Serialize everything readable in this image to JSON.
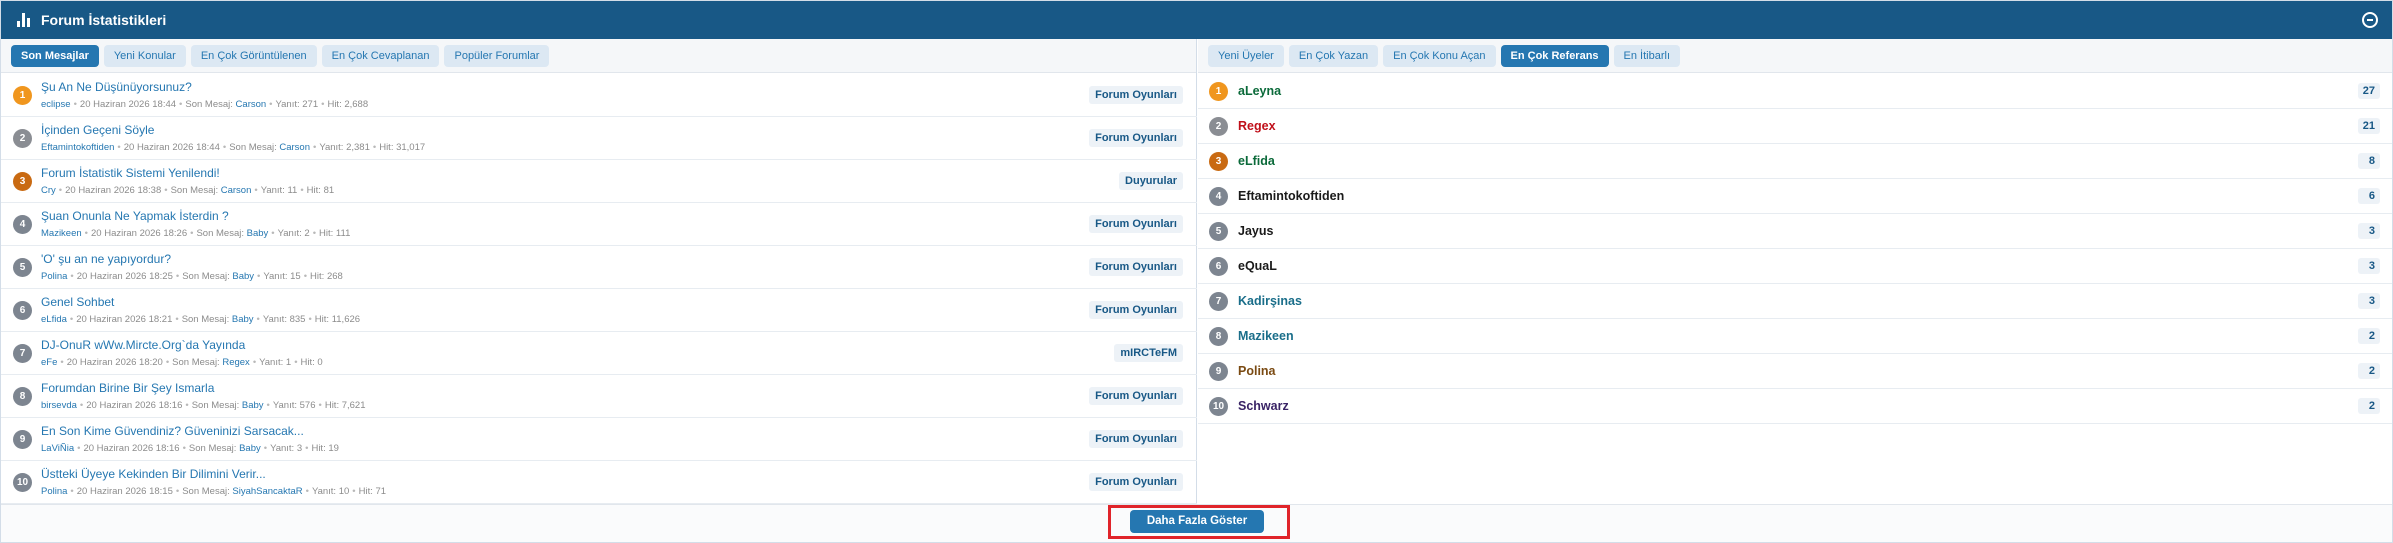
{
  "header": {
    "title": "Forum İstatistikleri",
    "icon": "bar-chart-icon",
    "toggle_icon": "collapse-icon"
  },
  "colors": {
    "header_bg": "#185886",
    "accent": "#2577b1",
    "gold": "#f0961e",
    "silver": "#8a8d93",
    "bronze": "#c96a12",
    "gray": "#7d8590"
  },
  "left_tabs": [
    {
      "label": "Son Mesajlar",
      "active": true
    },
    {
      "label": "Yeni Konular",
      "active": false
    },
    {
      "label": "En Çok Görüntülenen",
      "active": false
    },
    {
      "label": "En Çok Cevaplanan",
      "active": false
    },
    {
      "label": "Popüler Forumlar",
      "active": false
    }
  ],
  "right_tabs": [
    {
      "label": "Yeni Üyeler",
      "active": false
    },
    {
      "label": "En Çok Yazan",
      "active": false
    },
    {
      "label": "En Çok Konu Açan",
      "active": false
    },
    {
      "label": "En Çok Referans",
      "active": true
    },
    {
      "label": "En İtibarlı",
      "active": false
    }
  ],
  "labels": {
    "last_post": "Son Mesaj:",
    "replies": "Yanıt:",
    "hits": "Hit:"
  },
  "topics": [
    {
      "rank": "1",
      "title": "Şu An Ne Düşünüyorsunuz?",
      "author": "eclipse",
      "date": "20 Haziran 2026 18:44",
      "last_poster": "Carson",
      "replies": "271",
      "hits": "2,688",
      "forum": "Forum Oyunları"
    },
    {
      "rank": "2",
      "title": "İçinden Geçeni Söyle",
      "author": "Eftamintokoftiden",
      "date": "20 Haziran 2026 18:44",
      "last_poster": "Carson",
      "replies": "2,381",
      "hits": "31,017",
      "forum": "Forum Oyunları"
    },
    {
      "rank": "3",
      "title": "Forum İstatistik Sistemi Yenilendi!",
      "author": "Cry",
      "date": "20 Haziran 2026 18:38",
      "last_poster": "Carson",
      "replies": "11",
      "hits": "81",
      "forum": "Duyurular"
    },
    {
      "rank": "4",
      "title": "Şuan Onunla Ne Yapmak İsterdin ?",
      "author": "Mazikeen",
      "date": "20 Haziran 2026 18:26",
      "last_poster": "Baby",
      "replies": "2",
      "hits": "111",
      "forum": "Forum Oyunları"
    },
    {
      "rank": "5",
      "title": "'O' şu an ne yapıyordur?",
      "author": "Polina",
      "date": "20 Haziran 2026 18:25",
      "last_poster": "Baby",
      "replies": "15",
      "hits": "268",
      "forum": "Forum Oyunları"
    },
    {
      "rank": "6",
      "title": "Genel Sohbet",
      "author": "eLfida",
      "date": "20 Haziran 2026 18:21",
      "last_poster": "Baby",
      "replies": "835",
      "hits": "11,626",
      "forum": "Forum Oyunları"
    },
    {
      "rank": "7",
      "title": "DJ-OnuR wWw.Mircte.Org`da Yayında",
      "author": "eFe",
      "date": "20 Haziran 2026 18:20",
      "last_poster": "Regex",
      "replies": "1",
      "hits": "0",
      "forum": "mIRCTeFM"
    },
    {
      "rank": "8",
      "title": "Forumdan Birine Bir Şey Ismarla",
      "author": "birsevda",
      "date": "20 Haziran 2026 18:16",
      "last_poster": "Baby",
      "replies": "576",
      "hits": "7,621",
      "forum": "Forum Oyunları"
    },
    {
      "rank": "9",
      "title": "En Son Kime Güvendiniz? Güveninizi Sarsacak...",
      "author": "LaViÑia",
      "date": "20 Haziran 2026 18:16",
      "last_poster": "Baby",
      "replies": "3",
      "hits": "19",
      "forum": "Forum Oyunları"
    },
    {
      "rank": "10",
      "title": "Üstteki Üyeye Kekinden Bir Dilimini Verir...",
      "author": "Polina",
      "date": "20 Haziran 2026 18:15",
      "last_poster": "SiyahSancaktaR",
      "replies": "10",
      "hits": "71",
      "forum": "Forum Oyunları"
    }
  ],
  "users": [
    {
      "rank": "1",
      "name": "aLeyna",
      "count": "27",
      "color": "#0b6a3a"
    },
    {
      "rank": "2",
      "name": "Regex",
      "count": "21",
      "color": "#c0101a"
    },
    {
      "rank": "3",
      "name": "eLfida",
      "count": "8",
      "color": "#0b6a3a"
    },
    {
      "rank": "4",
      "name": "Eftamintokoftiden",
      "count": "6",
      "color": "#1a1a1a"
    },
    {
      "rank": "5",
      "name": "Jayus",
      "count": "3",
      "color": "#1a1a1a"
    },
    {
      "rank": "6",
      "name": "eQuaL",
      "count": "3",
      "color": "#1a1a1a"
    },
    {
      "rank": "7",
      "name": "Kadirşinas",
      "count": "3",
      "color": "#1a6e8a"
    },
    {
      "rank": "8",
      "name": "Mazikeen",
      "count": "2",
      "color": "#1a6e8a"
    },
    {
      "rank": "9",
      "name": "Polina",
      "count": "2",
      "color": "#7a4a12"
    },
    {
      "rank": "10",
      "name": "Schwarz",
      "count": "2",
      "color": "#3a2466"
    }
  ],
  "footer": {
    "more_button": "Daha Fazla Göster"
  }
}
